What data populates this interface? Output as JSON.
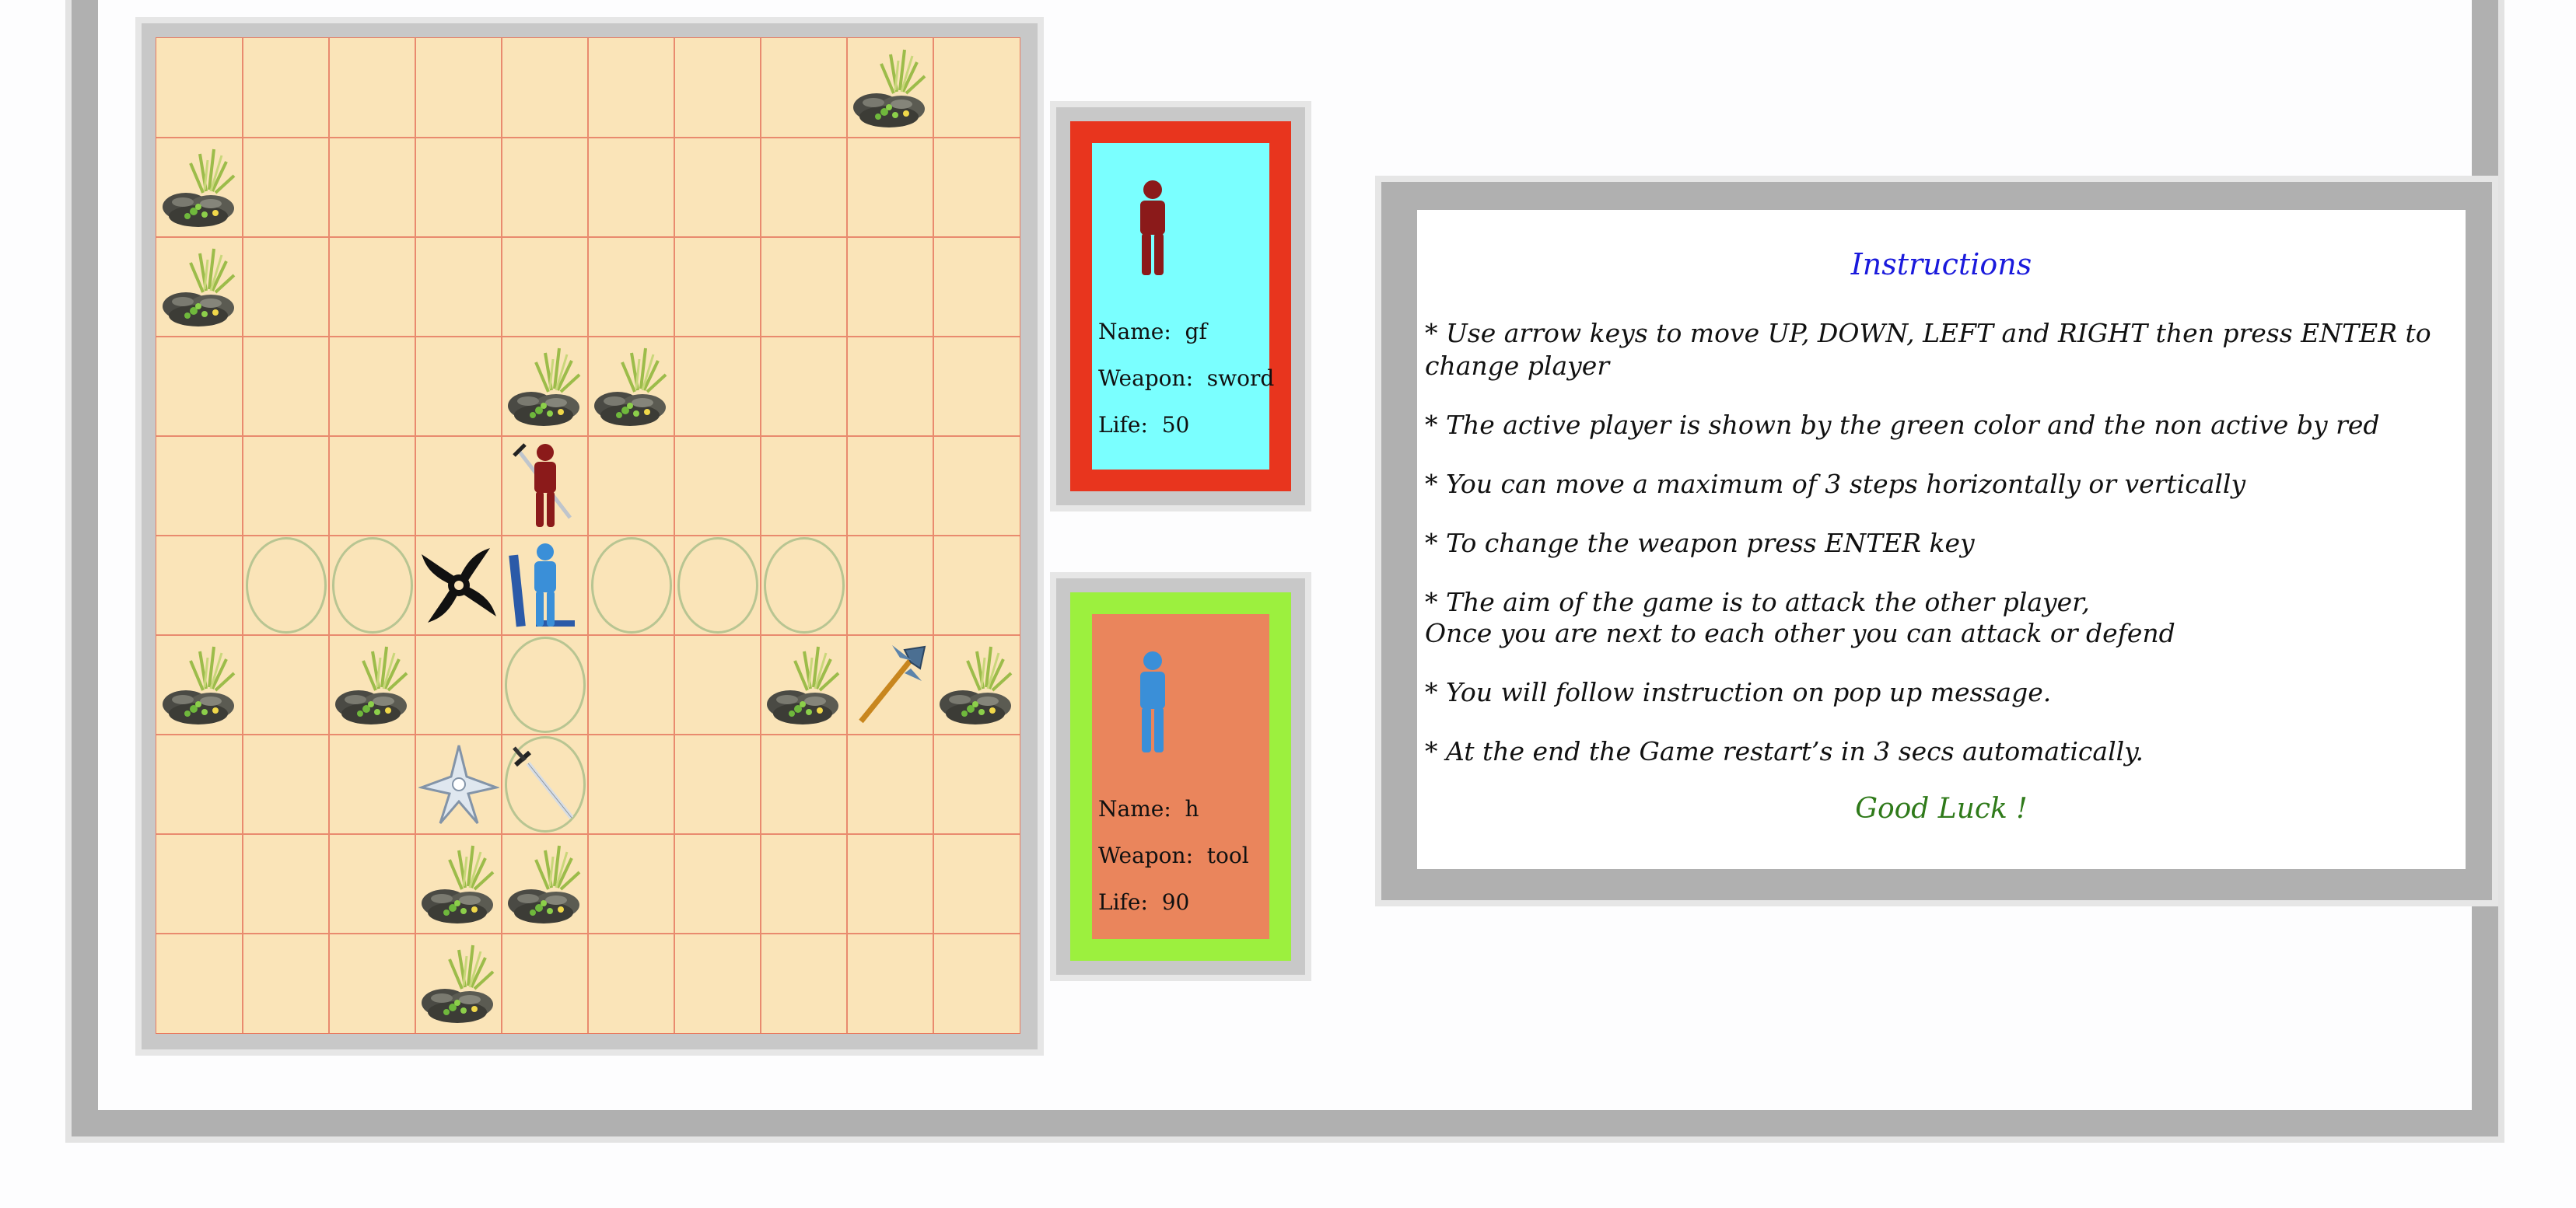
{
  "board": {
    "columns": 10,
    "rows": 10,
    "rocks": [
      [
        8,
        0
      ],
      [
        0,
        1
      ],
      [
        0,
        2
      ],
      [
        4,
        3
      ],
      [
        5,
        3
      ],
      [
        0,
        6
      ],
      [
        2,
        6
      ],
      [
        7,
        6
      ],
      [
        9,
        6
      ],
      [
        3,
        8
      ],
      [
        4,
        8
      ],
      [
        3,
        9
      ]
    ],
    "move_hints": [
      [
        1,
        5
      ],
      [
        2,
        5
      ],
      [
        5,
        5
      ],
      [
        6,
        5
      ],
      [
        7,
        5
      ],
      [
        4,
        6
      ],
      [
        4,
        7
      ]
    ],
    "weapons": [
      {
        "name": "shuriken-icon",
        "col": 3,
        "row": 5
      },
      {
        "name": "axe-icon",
        "col": 8,
        "row": 6
      },
      {
        "name": "star-icon",
        "col": 3,
        "row": 7
      },
      {
        "name": "sword-icon",
        "col": 4,
        "row": 7
      }
    ],
    "players": [
      {
        "name": "player-red-piece",
        "col": 4,
        "row": 4,
        "color": "#8b1a1a"
      },
      {
        "name": "player-blue-piece",
        "col": 4,
        "row": 5,
        "color": "#3a8fd8"
      }
    ]
  },
  "player1": {
    "name_label": "Name:  gf",
    "weapon_label": "Weapon:  sword",
    "life_label": "Life:  50",
    "border_color": "#e8351e",
    "background_color": "#7affff",
    "avatar_color": "#8b1a1a"
  },
  "player2": {
    "name_label": "Name:  h",
    "weapon_label": "Weapon:  tool",
    "life_label": "Life:  90",
    "border_color": "#9cf03e",
    "background_color": "#ea855c",
    "avatar_color": "#3a8fd8"
  },
  "instructions": {
    "title": "Instructions",
    "lines": [
      "* Use arrow keys to move UP, DOWN, LEFT and RIGHT then press ENTER to change player",
      "* The active player is shown by the green color and the non active by red",
      "* You can move a maximum of 3 steps horizontally or vertically",
      "* To change the weapon press ENTER key",
      "* The aim of the game is to attack the other player,",
      "Once you are next to each other you can attack or defend",
      "* You will follow instruction on pop up message.",
      "* At the end the Game restart’s in 3 secs automatically."
    ],
    "good_luck": "Good Luck !"
  }
}
